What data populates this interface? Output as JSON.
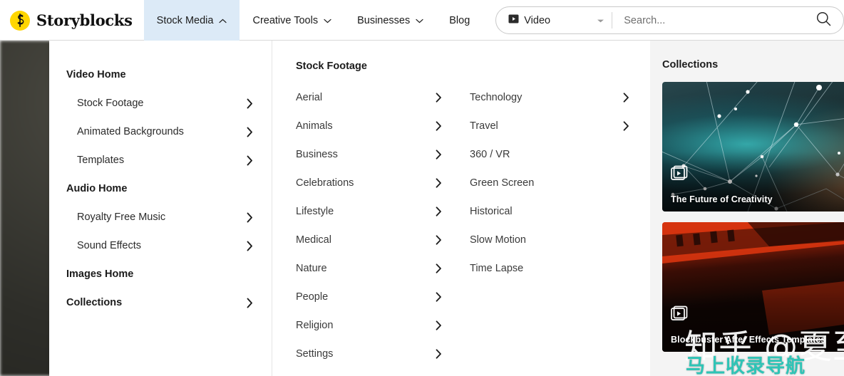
{
  "header": {
    "brand": "Storyblocks",
    "brand_icon": "storyblocks-logo-icon",
    "nav": [
      {
        "label": "Stock Media",
        "caret": "chevron-up-icon",
        "active": true
      },
      {
        "label": "Creative Tools",
        "caret": "chevron-down-icon",
        "active": false
      },
      {
        "label": "Businesses",
        "caret": "chevron-down-icon",
        "active": false
      },
      {
        "label": "Blog",
        "caret": "",
        "active": false
      }
    ],
    "search": {
      "type_value": "Video",
      "type_icon": "video-play-icon",
      "type_caret": "chevron-down-icon",
      "placeholder": "Search...",
      "value": "",
      "search_icon": "search-icon"
    },
    "accent_active_bg": "#dceaf7",
    "brand_color": "#ffd600"
  },
  "mega_menu": {
    "primary": [
      {
        "label": "Video Home",
        "type": "head",
        "chevron": false
      },
      {
        "label": "Stock Footage",
        "type": "sub",
        "chevron": true
      },
      {
        "label": "Animated Backgrounds",
        "type": "sub",
        "chevron": true
      },
      {
        "label": "Templates",
        "type": "sub",
        "chevron": true
      },
      {
        "label": "Audio Home",
        "type": "head",
        "chevron": false
      },
      {
        "label": "Royalty Free Music",
        "type": "sub",
        "chevron": true
      },
      {
        "label": "Sound Effects",
        "type": "sub",
        "chevron": true
      },
      {
        "label": "Images Home",
        "type": "head",
        "chevron": false
      },
      {
        "label": "Collections",
        "type": "head",
        "chevron": true
      }
    ],
    "categories_title": "Stock Footage",
    "categories_col1": [
      {
        "label": "Aerial",
        "chevron": true
      },
      {
        "label": "Animals",
        "chevron": true
      },
      {
        "label": "Business",
        "chevron": true
      },
      {
        "label": "Celebrations",
        "chevron": true
      },
      {
        "label": "Lifestyle",
        "chevron": true
      },
      {
        "label": "Medical",
        "chevron": true
      },
      {
        "label": "Nature",
        "chevron": true
      },
      {
        "label": "People",
        "chevron": true
      },
      {
        "label": "Religion",
        "chevron": true
      },
      {
        "label": "Settings",
        "chevron": true
      }
    ],
    "categories_col2": [
      {
        "label": "Technology",
        "chevron": true
      },
      {
        "label": "Travel",
        "chevron": true
      },
      {
        "label": "360 / VR",
        "chevron": false
      },
      {
        "label": "Green Screen",
        "chevron": false
      },
      {
        "label": "Historical",
        "chevron": false
      },
      {
        "label": "Slow Motion",
        "chevron": false
      },
      {
        "label": "Time Lapse",
        "chevron": false
      }
    ],
    "collections": {
      "title": "Collections",
      "cards": [
        {
          "title": "The Future of Creativity",
          "icon": "video-stack-icon"
        },
        {
          "title": "Blockbuster After Effects Templates",
          "icon": "video-stack-icon"
        }
      ]
    }
  },
  "watermark": {
    "zhihu": "知乎 @夏至",
    "nav": "马上收录导航"
  }
}
